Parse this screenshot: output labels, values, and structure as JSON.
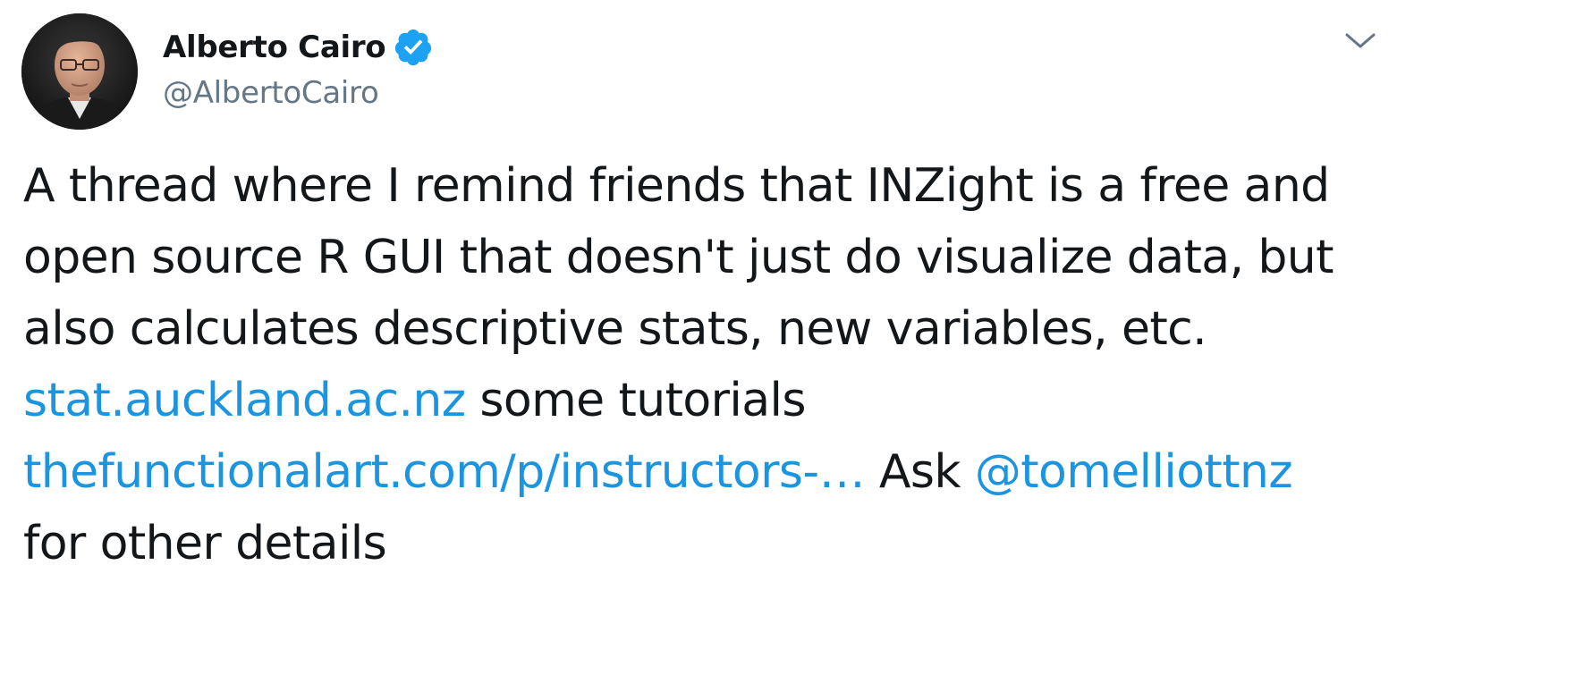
{
  "author": {
    "display_name": "Alberto Cairo",
    "handle": "@AlbertoCairo",
    "verified": true
  },
  "tweet": {
    "segments": {
      "t1": "A thread where I remind friends that INZight is a free and open source R GUI that doesn't just do visualize data, but also calculates descriptive stats, new variables, etc. ",
      "link1": "stat.auckland.ac.nz",
      "t2": " some tutorials ",
      "link2": "thefunctionalart.com/p/instructors-…",
      "t3": " Ask ",
      "mention": "@tomelliottnz",
      "t4": " for other details"
    }
  },
  "icons": {
    "verified": "verified-badge-icon",
    "menu": "chevron-down-icon"
  },
  "colors": {
    "text": "#14171a",
    "secondary": "#657786",
    "link": "#1b95e0",
    "verified": "#1da1f2"
  }
}
